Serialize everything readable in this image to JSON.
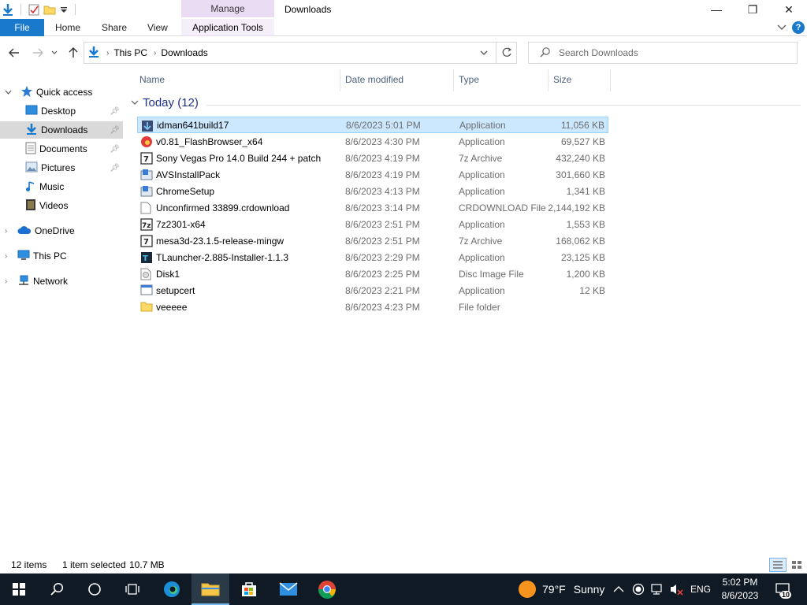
{
  "window": {
    "title": "Downloads",
    "manage_label": "Manage",
    "minimize": "—",
    "maximize": "❐",
    "close": "✕"
  },
  "ribbon": {
    "file": "File",
    "tabs": [
      "Home",
      "Share",
      "View"
    ],
    "app_tools": "Application Tools",
    "help": "?"
  },
  "address": {
    "segments": [
      "This PC",
      "Downloads"
    ],
    "search_placeholder": "Search Downloads"
  },
  "nav_pane": {
    "quick_access": "Quick access",
    "items": [
      {
        "label": "Desktop",
        "pinned": true
      },
      {
        "label": "Downloads",
        "pinned": true
      },
      {
        "label": "Documents",
        "pinned": true
      },
      {
        "label": "Pictures",
        "pinned": true
      },
      {
        "label": "Music",
        "pinned": false
      },
      {
        "label": "Videos",
        "pinned": false
      }
    ],
    "onedrive": "OneDrive",
    "this_pc": "This PC",
    "network": "Network"
  },
  "columns": [
    "Name",
    "Date modified",
    "Type",
    "Size"
  ],
  "group": {
    "label": "Today (12)"
  },
  "files": [
    {
      "name": "idman641build17",
      "date": "8/6/2023 5:01 PM",
      "type": "Application",
      "size": "11,056 KB",
      "icon": "idm-icon"
    },
    {
      "name": "v0.81_FlashBrowser_x64",
      "date": "8/6/2023 4:30 PM",
      "type": "Application",
      "size": "69,527 KB",
      "icon": "flash-icon"
    },
    {
      "name": "Sony Vegas Pro 14.0 Build 244 + patch",
      "date": "8/6/2023 4:19 PM",
      "type": "7z Archive",
      "size": "432,240 KB",
      "icon": "archive-icon"
    },
    {
      "name": "AVSInstallPack",
      "date": "8/6/2023 4:19 PM",
      "type": "Application",
      "size": "301,660 KB",
      "icon": "installer-icon"
    },
    {
      "name": "ChromeSetup",
      "date": "8/6/2023 4:13 PM",
      "type": "Application",
      "size": "1,341 KB",
      "icon": "installer-icon"
    },
    {
      "name": "Unconfirmed 33899.crdownload",
      "date": "8/6/2023 3:14 PM",
      "type": "CRDOWNLOAD File",
      "size": "2,144,192 KB",
      "icon": "blank-file-icon"
    },
    {
      "name": "7z2301-x64",
      "date": "8/6/2023 2:51 PM",
      "type": "Application",
      "size": "1,553 KB",
      "icon": "7zip-icon"
    },
    {
      "name": "mesa3d-23.1.5-release-mingw",
      "date": "8/6/2023 2:51 PM",
      "type": "7z Archive",
      "size": "168,062 KB",
      "icon": "archive-icon"
    },
    {
      "name": "TLauncher-2.885-Installer-1.1.3",
      "date": "8/6/2023 2:29 PM",
      "type": "Application",
      "size": "23,125 KB",
      "icon": "tlauncher-icon"
    },
    {
      "name": "Disk1",
      "date": "8/6/2023 2:25 PM",
      "type": "Disc Image File",
      "size": "1,200 KB",
      "icon": "disc-image-icon"
    },
    {
      "name": "setupcert",
      "date": "8/6/2023 2:21 PM",
      "type": "Application",
      "size": "12 KB",
      "icon": "app-window-icon"
    },
    {
      "name": "veeeee",
      "date": "8/6/2023 4:23 PM",
      "type": "File folder",
      "size": "",
      "icon": "folder-icon"
    }
  ],
  "selected_index": 0,
  "status": {
    "count": "12 items",
    "selection": "1 item selected",
    "size": "10.7 MB"
  },
  "taskbar": {
    "weather_temp": "79°F",
    "weather_cond": "Sunny",
    "lang": "ENG",
    "time": "5:02 PM",
    "date": "8/6/2023",
    "notifications": "10"
  },
  "colors": {
    "file_tab": "#1979ca",
    "manage_tab": "#eadcf3",
    "selection": "#cce8ff",
    "group_header": "#1e3287",
    "taskbar": "#101a24"
  }
}
